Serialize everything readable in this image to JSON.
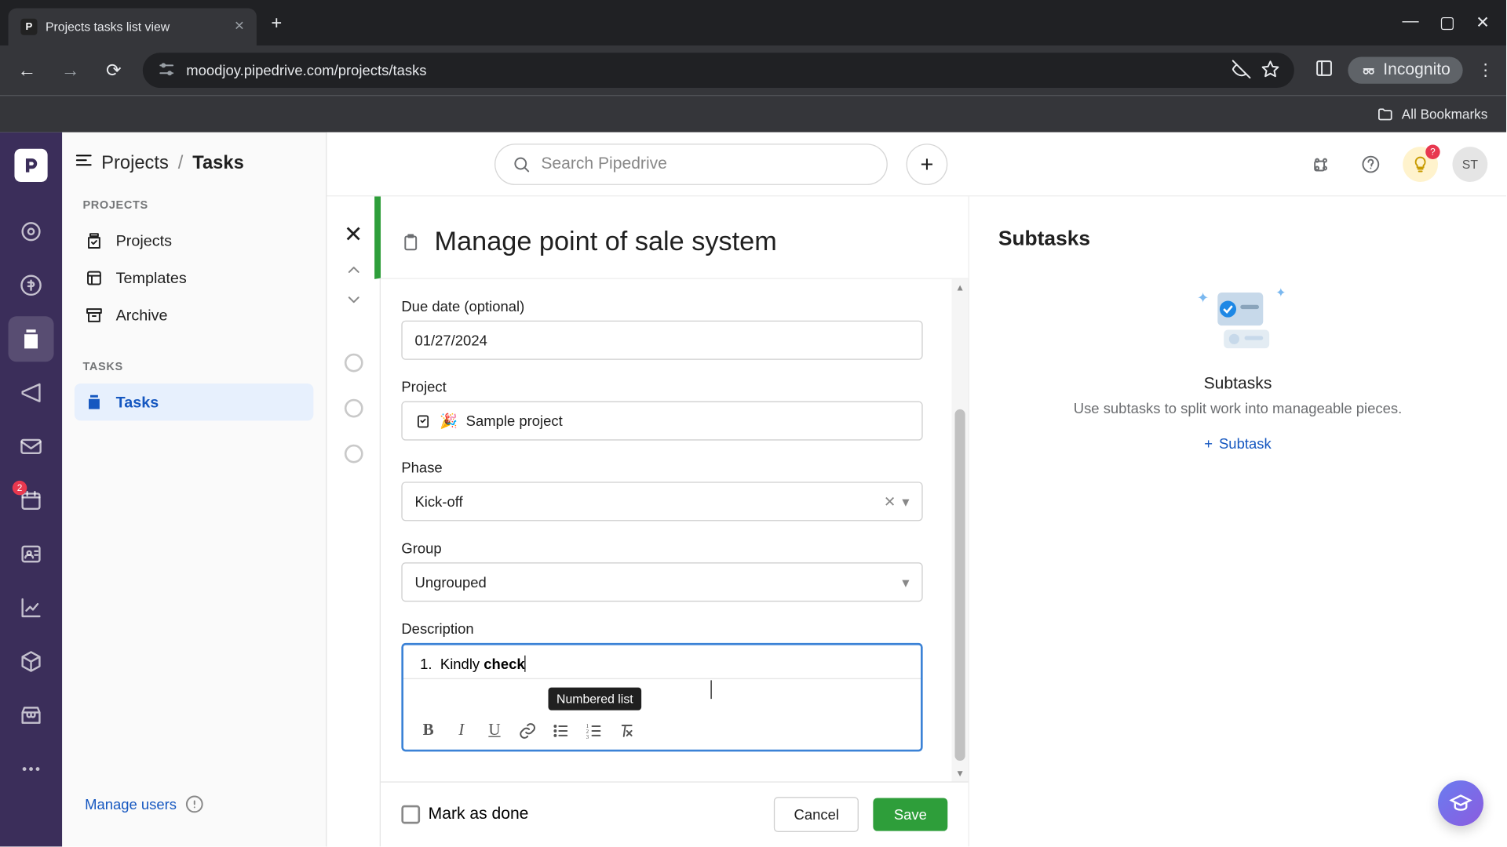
{
  "browser": {
    "tab_title": "Projects tasks list view",
    "tab_favicon": "P",
    "url": "moodjoy.pipedrive.com/projects/tasks",
    "incognito_label": "Incognito",
    "all_bookmarks": "All Bookmarks"
  },
  "top_bar": {
    "search_placeholder": "Search Pipedrive",
    "avatar_initials": "ST",
    "bulb_badge": "?"
  },
  "left_rail": {
    "badge_count": "2"
  },
  "sidebar": {
    "breadcrumb_parent": "Projects",
    "breadcrumb_sep": "/",
    "breadcrumb_current": "Tasks",
    "section_projects": "PROJECTS",
    "section_tasks": "TASKS",
    "items_projects": [
      {
        "label": "Projects"
      },
      {
        "label": "Templates"
      },
      {
        "label": "Archive"
      }
    ],
    "items_tasks": [
      {
        "label": "Tasks"
      }
    ],
    "manage_users": "Manage users"
  },
  "task": {
    "title": "Manage point of sale system",
    "due_date_label": "Due date (optional)",
    "due_date_value": "01/27/2024",
    "project_label": "Project",
    "project_value": "Sample project",
    "phase_label": "Phase",
    "phase_value": "Kick-off",
    "group_label": "Group",
    "group_value": "Ungrouped",
    "description_label": "Description",
    "description_item_number": "1.",
    "description_text_plain": "Kindly ",
    "description_text_bold": "check",
    "toolbar_tooltip": "Numbered list",
    "mark_done_label": "Mark as done",
    "cancel_label": "Cancel",
    "save_label": "Save"
  },
  "subtasks_pane": {
    "heading": "Subtasks",
    "empty_title": "Subtasks",
    "empty_desc": "Use subtasks to split work into manageable pieces.",
    "add_label": "Subtask"
  }
}
